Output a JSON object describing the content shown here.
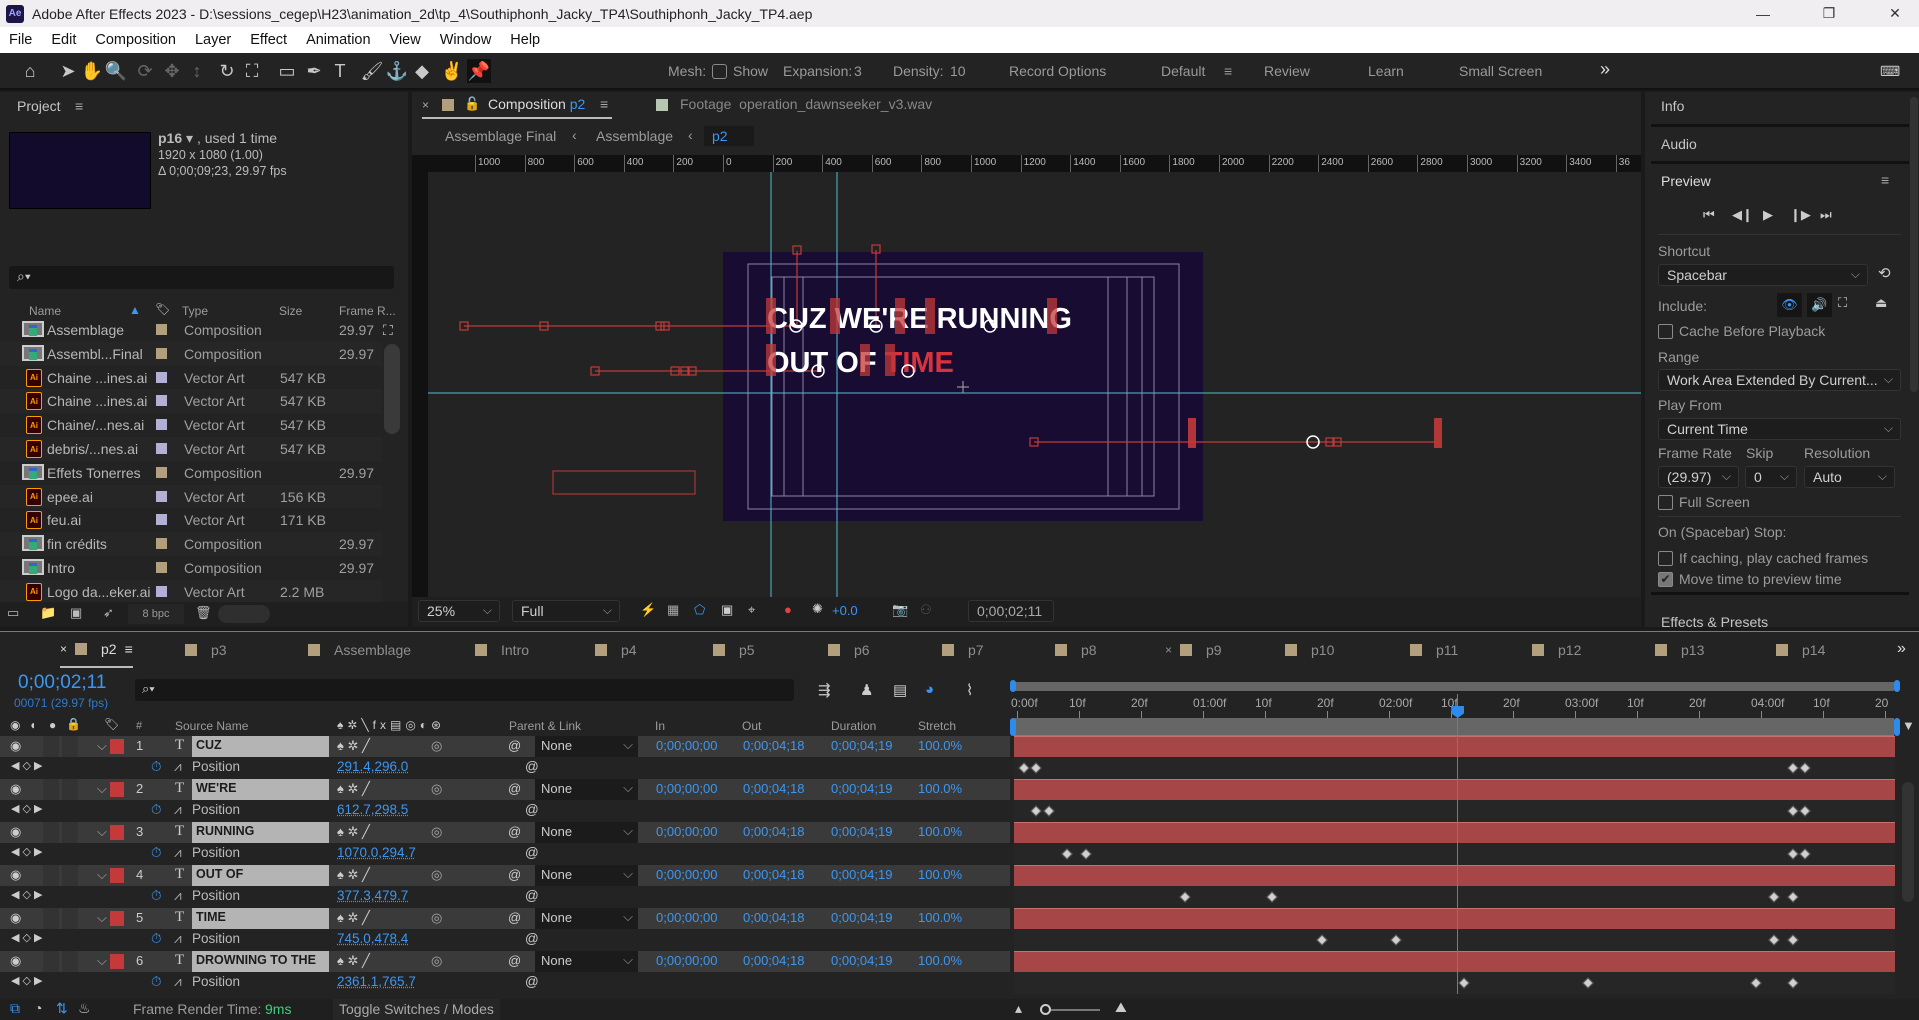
{
  "app": {
    "title": "Adobe After Effects 2023 - D:\\sessions_cegep\\H23\\animation_2d\\tp_4\\Southiphonh_Jacky_TP4\\Southiphonh_Jacky_TP4.aep",
    "logo": "Ae"
  },
  "menu": [
    "File",
    "Edit",
    "Composition",
    "Layer",
    "Effect",
    "Animation",
    "View",
    "Window",
    "Help"
  ],
  "toolbar": {
    "tools": [
      "home-icon",
      "selection-icon",
      "hand-icon",
      "zoom-icon",
      "orbit-icon",
      "pan-icon",
      "dolly-icon",
      "rotate-icon",
      "pan-behind-icon",
      "rectangle-icon",
      "pen-icon",
      "type-icon",
      "brush-icon",
      "clone-stamp-icon",
      "eraser-icon",
      "roto-brush-icon",
      "puppet-pin-icon"
    ],
    "mesh_label": "Mesh:",
    "show_label": "Show",
    "expansion_label": "Expansion:",
    "expansion_value": "3",
    "density_label": "Density:",
    "density_value": "10",
    "record_options": "Record Options",
    "workspaces": [
      "Default",
      "Review",
      "Learn",
      "Small Screen"
    ],
    "more": "»"
  },
  "project": {
    "title": "Project",
    "selected": {
      "name": "p16",
      "usage": ", used 1 time",
      "dims": "1920 x 1080 (1.00)",
      "duration": "Δ 0;00;09;23, 29.97 fps"
    },
    "search_placeholder": "",
    "columns": [
      "Name",
      "Type",
      "Size",
      "Frame R..."
    ],
    "items": [
      {
        "name": "Assemblage",
        "kind": "comp",
        "type": "Composition",
        "size": "",
        "fps": "29.97"
      },
      {
        "name": "Assembl...Final",
        "kind": "comp",
        "type": "Composition",
        "size": "",
        "fps": "29.97"
      },
      {
        "name": "Chaine ...ines.ai",
        "kind": "ai",
        "type": "Vector Art",
        "size": "547 KB",
        "fps": ""
      },
      {
        "name": "Chaine ...ines.ai",
        "kind": "ai",
        "type": "Vector Art",
        "size": "547 KB",
        "fps": ""
      },
      {
        "name": "Chaine/...nes.ai",
        "kind": "ai",
        "type": "Vector Art",
        "size": "547 KB",
        "fps": ""
      },
      {
        "name": "debris/...nes.ai",
        "kind": "ai",
        "type": "Vector Art",
        "size": "547 KB",
        "fps": ""
      },
      {
        "name": "Effets Tonerres",
        "kind": "comp",
        "type": "Composition",
        "size": "",
        "fps": "29.97"
      },
      {
        "name": "epee.ai",
        "kind": "ai",
        "type": "Vector Art",
        "size": "156 KB",
        "fps": ""
      },
      {
        "name": "feu.ai",
        "kind": "ai",
        "type": "Vector Art",
        "size": "171 KB",
        "fps": ""
      },
      {
        "name": "fin crédits",
        "kind": "comp",
        "type": "Composition",
        "size": "",
        "fps": "29.97"
      },
      {
        "name": "Intro",
        "kind": "comp",
        "type": "Composition",
        "size": "",
        "fps": "29.97"
      },
      {
        "name": "Logo da...eker.ai",
        "kind": "ai",
        "type": "Vector Art",
        "size": "2.2 MB",
        "fps": ""
      }
    ],
    "bpc": "8 bpc"
  },
  "composition": {
    "tab_prefix": "Composition",
    "tab_name": "p2",
    "footage_prefix": "Footage",
    "footage_name": "operation_dawnseeker_v3.wav",
    "breadcrumbs": [
      "Assemblage Final",
      "Assemblage",
      "p2"
    ],
    "ruler": [
      "1000",
      "800",
      "600",
      "400",
      "200",
      "0",
      "200",
      "400",
      "600",
      "800",
      "1000",
      "1200",
      "1400",
      "1600",
      "1800",
      "2000",
      "2200",
      "2400",
      "2600",
      "2800",
      "3000",
      "3200",
      "3400",
      "36"
    ],
    "line1": "CUZ WE'RE RUNNING",
    "line2a": "OUT OF ",
    "line2b": "TIME",
    "zoom": "25%",
    "resolution": "Full",
    "exposure": "+0.0",
    "timecode": "0;00;02;11",
    "bg_color": "#190c33"
  },
  "right": {
    "info": "Info",
    "audio": "Audio",
    "preview": "Preview",
    "shortcut_label": "Shortcut",
    "shortcut": "Spacebar",
    "include_label": "Include:",
    "cache_before": "Cache Before Playback",
    "range_label": "Range",
    "range": "Work Area Extended By Current...",
    "play_from_label": "Play From",
    "play_from": "Current Time",
    "frame_rate_label": "Frame Rate",
    "skip_label": "Skip",
    "resolution_label": "Resolution",
    "frame_rate": "(29.97)",
    "skip": "0",
    "resolution": "Auto",
    "full_screen": "Full Screen",
    "on_stop": "On (Spacebar) Stop:",
    "if_caching": "If caching, play cached frames",
    "move_time": "Move time to preview time",
    "move_time_checked": true,
    "effects": "Effects & Presets"
  },
  "timeline": {
    "tabs": [
      "p2",
      "p3",
      "Assemblage",
      "Intro",
      "p4",
      "p5",
      "p6",
      "p7",
      "p8",
      "p9",
      "p10",
      "p11",
      "p12",
      "p13",
      "p14"
    ],
    "active_tab": "p2",
    "current_time": "0;00;02;11",
    "frame_info": "00071 (29.97 fps)",
    "columns": {
      "num": "#",
      "source": "Source Name",
      "parent": "Parent & Link",
      "in": "In",
      "out": "Out",
      "duration": "Duration",
      "stretch": "Stretch"
    },
    "ruler": [
      "0:00f",
      "10f",
      "20f",
      "01:00f",
      "10f",
      "20f",
      "02:00f",
      "10f",
      "20f",
      "03:00f",
      "10f",
      "20f",
      "04:00f",
      "10f",
      "20"
    ],
    "current_frame": 71,
    "layers": [
      {
        "num": "1",
        "name": "CUZ",
        "parent": "None",
        "in": "0;00;00;00",
        "out": "0;00;04;18",
        "duration": "0;00;04;19",
        "stretch": "100.0%",
        "prop": "Position",
        "value": "291.4,296.0",
        "keyframes": [
          0,
          2,
          124,
          126
        ]
      },
      {
        "num": "2",
        "name": "WE'RE",
        "parent": "None",
        "in": "0;00;00;00",
        "out": "0;00;04;18",
        "duration": "0;00;04;19",
        "stretch": "100.0%",
        "prop": "Position",
        "value": "612.7,298.5",
        "keyframes": [
          2,
          4,
          124,
          126
        ]
      },
      {
        "num": "3",
        "name": "RUNNING",
        "parent": "None",
        "in": "0;00;00;00",
        "out": "0;00;04;18",
        "duration": "0;00;04;19",
        "stretch": "100.0%",
        "prop": "Position",
        "value": "1070.0,294.7",
        "keyframes": [
          7,
          10,
          124,
          126
        ]
      },
      {
        "num": "4",
        "name": "OUT OF",
        "parent": "None",
        "in": "0;00;00;00",
        "out": "0;00;04;18",
        "duration": "0;00;04;19",
        "stretch": "100.0%",
        "prop": "Position",
        "value": "377.3,479.7",
        "keyframes": [
          26,
          40,
          121,
          124
        ]
      },
      {
        "num": "5",
        "name": "TIME",
        "parent": "None",
        "in": "0;00;00;00",
        "out": "0;00;04;18",
        "duration": "0;00;04;19",
        "stretch": "100.0%",
        "prop": "Position",
        "value": "745.0,478.4",
        "keyframes": [
          48,
          60,
          121,
          124
        ]
      },
      {
        "num": "6",
        "name": "DROWNING TO THE",
        "parent": "None",
        "in": "0;00;00;00",
        "out": "0;00;04;18",
        "duration": "0;00;04;19",
        "stretch": "100.0%",
        "prop": "Position",
        "value": "2361.1,765.7",
        "keyframes": [
          71,
          91,
          118,
          124
        ]
      }
    ],
    "render_label": "Frame Render Time:",
    "render_time": "9ms",
    "toggle": "Toggle Switches / Modes",
    "colors": {
      "label": "#c43a3a",
      "track": "#a64646",
      "accent": "#3d97f0",
      "render": "#3fd07a"
    }
  }
}
